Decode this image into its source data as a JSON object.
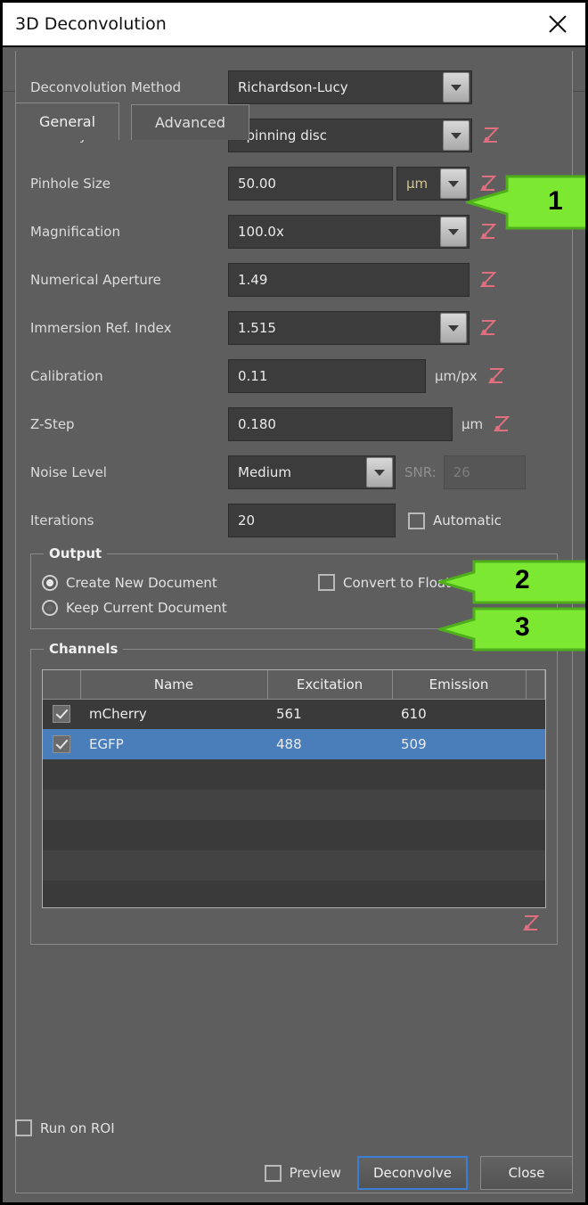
{
  "window": {
    "title": "3D Deconvolution",
    "close_icon": "close-icon"
  },
  "toolbar": {
    "undo_icon": "undo-icon",
    "redo_icon": "redo-icon"
  },
  "tabs": [
    {
      "label": "General",
      "active": true
    },
    {
      "label": "Advanced",
      "active": false
    }
  ],
  "form": {
    "rows": [
      {
        "label": "Deconvolution Method",
        "value": "Richardson-Lucy"
      },
      {
        "label": "Modality",
        "value": "Spinning disc"
      },
      {
        "label": "Pinhole Size",
        "value": "50.00",
        "unit": "µm"
      },
      {
        "label": "Magnification",
        "value": "100.0x"
      },
      {
        "label": "Numerical Aperture",
        "value": "1.49"
      },
      {
        "label": "Immersion Ref. Index",
        "value": "1.515"
      },
      {
        "label": "Calibration",
        "value": "0.11",
        "unit": "µm/px"
      },
      {
        "label": "Z-Step",
        "value": "0.180",
        "unit": "µm"
      },
      {
        "label": "Noise Level",
        "value": "Medium"
      },
      {
        "label": "Iterations",
        "value": "20"
      }
    ],
    "snr_label": "SNR:",
    "snr_value": "26",
    "automatic_label": "Automatic",
    "reset_icon": "reset-icon"
  },
  "output": {
    "title": "Output",
    "create_new_document": "Create New Document",
    "keep_current_document": "Keep Current Document",
    "convert_to_float": "Convert to Float"
  },
  "channels": {
    "title": "Channels",
    "columns": [
      "",
      "Name",
      "Excitation",
      "Emission",
      ""
    ],
    "rows": [
      {
        "checked": true,
        "name": "mCherry",
        "excitation": "561",
        "emission": "610",
        "selected": false
      },
      {
        "checked": true,
        "name": "EGFP",
        "excitation": "488",
        "emission": "509",
        "selected": true
      }
    ],
    "reset_icon": "reset-icon"
  },
  "footer": {
    "run_on_roi": "Run on ROI",
    "preview": "Preview",
    "deconvolve": "Deconvolve",
    "close": "Close"
  },
  "annotations": [
    {
      "number": "1"
    },
    {
      "number": "2"
    },
    {
      "number": "3"
    }
  ],
  "colors": {
    "panel": "#5e5e5e",
    "field": "#3c3c3c",
    "accent_blue": "#3b7fd4",
    "row_selected": "#4a7ebb",
    "reset_pink": "#e07080",
    "annotation_green": "#7ce831"
  }
}
